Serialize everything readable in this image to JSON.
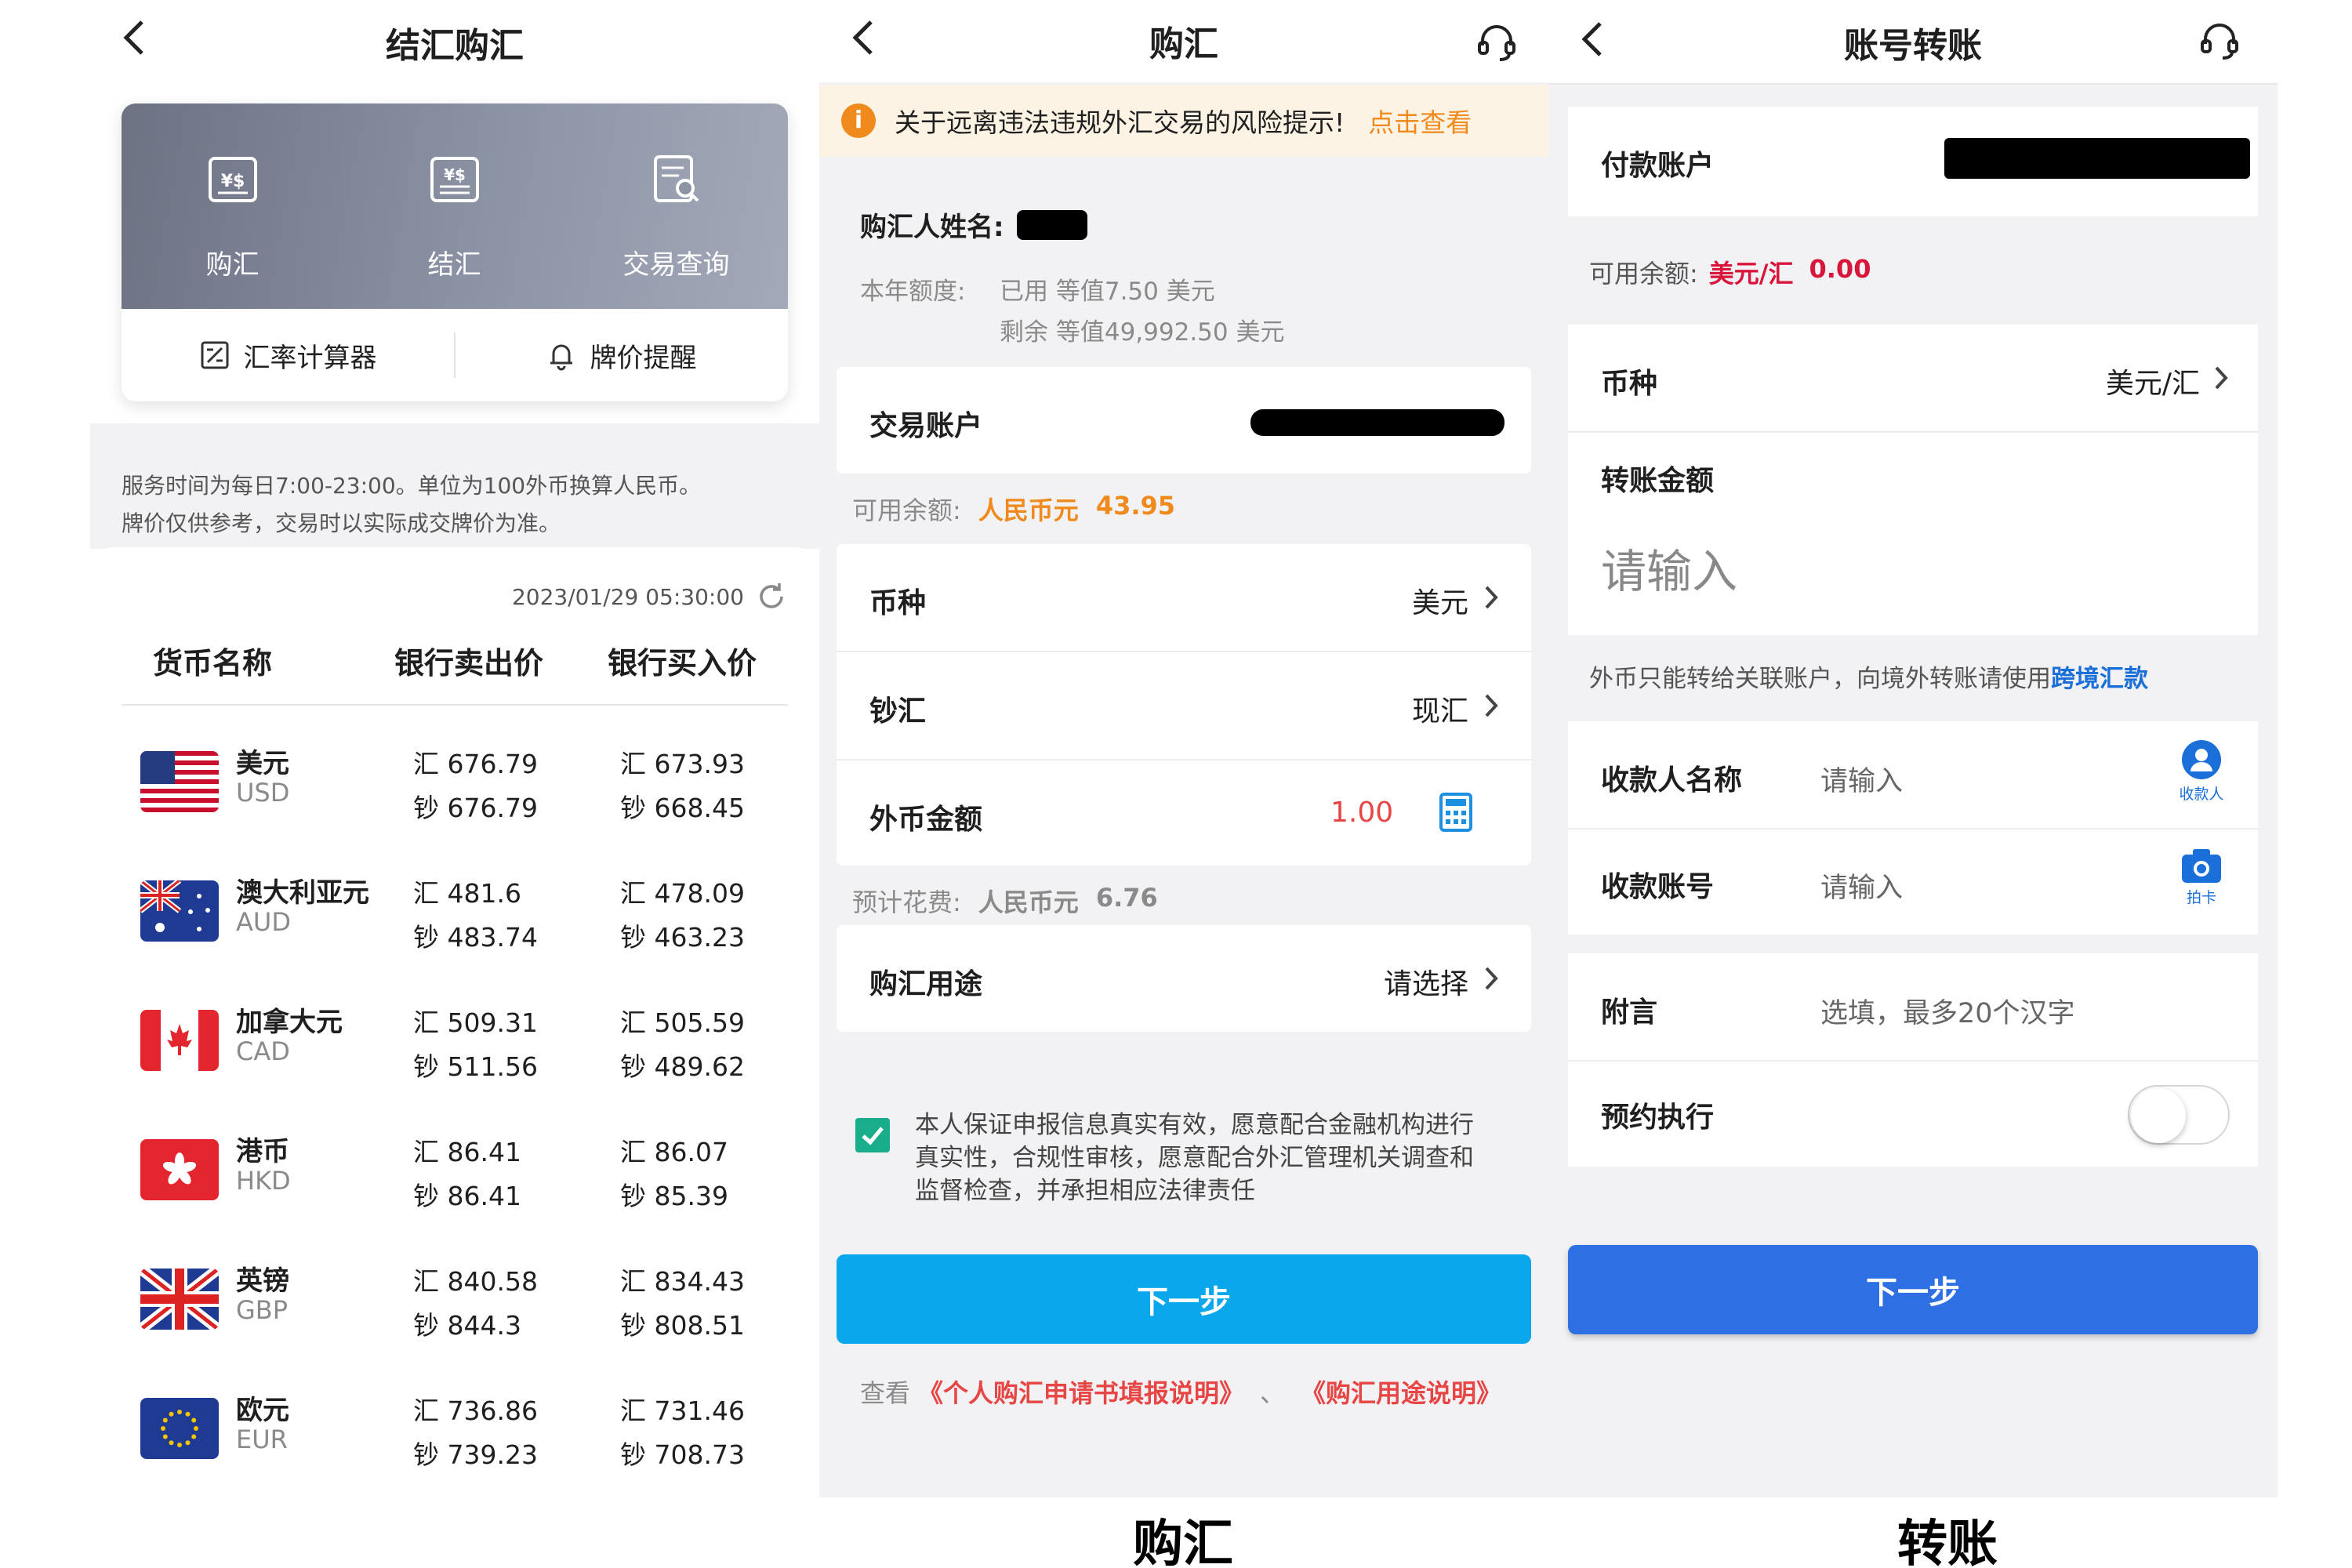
{
  "panel1": {
    "title": "结汇购汇",
    "quick_actions": [
      {
        "label": "购汇",
        "icon": "buy-fx-icon"
      },
      {
        "label": "结汇",
        "icon": "sell-fx-icon"
      },
      {
        "label": "交易查询",
        "icon": "query-icon"
      }
    ],
    "tools": [
      {
        "label": "汇率计算器",
        "icon": "calculator-icon"
      },
      {
        "label": "牌价提醒",
        "icon": "bell-icon"
      }
    ],
    "notice_line1": "服务时间为每日7:00-23:00。单位为100外币换算人民币。",
    "notice_line2": "牌价仅供参考，交易时以实际成交牌价为准。",
    "timestamp": "2023/01/29 05:30:00",
    "columns": [
      "货币名称",
      "银行卖出价",
      "银行买入价"
    ],
    "currencies": [
      {
        "name": "美元",
        "code": "USD",
        "flag": "us",
        "sell_hui": "汇 676.79",
        "sell_chao": "钞 676.79",
        "buy_hui": "汇 673.93",
        "buy_chao": "钞 668.45"
      },
      {
        "name": "澳大利亚元",
        "code": "AUD",
        "flag": "au",
        "sell_hui": "汇 481.6",
        "sell_chao": "钞 483.74",
        "buy_hui": "汇 478.09",
        "buy_chao": "钞 463.23"
      },
      {
        "name": "加拿大元",
        "code": "CAD",
        "flag": "ca",
        "sell_hui": "汇 509.31",
        "sell_chao": "钞 511.56",
        "buy_hui": "汇 505.59",
        "buy_chao": "钞 489.62"
      },
      {
        "name": "港币",
        "code": "HKD",
        "flag": "hk",
        "sell_hui": "汇 86.41",
        "sell_chao": "钞 86.41",
        "buy_hui": "汇 86.07",
        "buy_chao": "钞 85.39"
      },
      {
        "name": "英镑",
        "code": "GBP",
        "flag": "gb",
        "sell_hui": "汇 840.58",
        "sell_chao": "钞 844.3",
        "buy_hui": "汇 834.43",
        "buy_chao": "钞 808.51"
      },
      {
        "name": "欧元",
        "code": "EUR",
        "flag": "eu",
        "sell_hui": "汇 736.86",
        "sell_chao": "钞 739.23",
        "buy_hui": "汇 731.46",
        "buy_chao": "钞 708.73"
      }
    ]
  },
  "panel2": {
    "title": "购汇",
    "warning_text": "关于远离违法违规外汇交易的风险提示!",
    "warning_link": "点击查看",
    "buyer_label": "购汇人姓名:",
    "quota_label": "本年额度:",
    "quota_used": "已用 等值7.50 美元",
    "quota_remain": "剩余 等值49,992.50 美元",
    "account_label": "交易账户",
    "balance_label": "可用余额:",
    "balance_currency": "人民币元",
    "balance_amount": "43.95",
    "currency_label": "币种",
    "currency_value": "美元",
    "cash_label": "钞汇",
    "cash_value": "现汇",
    "amount_label": "外币金额",
    "amount_value": "1.00",
    "cost_label": "预计花费:",
    "cost_currency": "人民币元",
    "cost_amount": "6.76",
    "purpose_label": "购汇用途",
    "purpose_value": "请选择",
    "agreement_line1": "本人保证申报信息真实有效，愿意配合金融机构进行",
    "agreement_line2": "真实性，合规性审核，愿意配合外汇管理机关调查和",
    "agreement_line3": "监督检查，并承担相应法律责任",
    "next_label": "下一步",
    "links_prefix": "查看",
    "link1": "《个人购汇申请书填报说明》",
    "links_sep": "、",
    "link2": "《购汇用途说明》",
    "colors": {
      "accent_orange": "#f08a1c",
      "button_blue": "#0aa7ec",
      "red": "#e84545",
      "check_green": "#1aad8c"
    }
  },
  "panel3": {
    "title": "账号转账",
    "payer_label": "付款账户",
    "balance_label": "可用余额:",
    "balance_currency": "美元/汇",
    "balance_amount": "0.00",
    "currency_label": "币种",
    "currency_value": "美元/汇",
    "amount_label": "转账金额",
    "amount_placeholder": "请输入",
    "tip_text": "外币只能转给关联账户，向境外转账请使用",
    "tip_link": "跨境汇款",
    "payee_name_label": "收款人名称",
    "payee_name_placeholder": "请输入",
    "payee_icon_label": "收款人",
    "payee_account_label": "收款账号",
    "payee_account_placeholder": "请输入",
    "camera_label": "拍卡",
    "memo_label": "附言",
    "memo_placeholder": "选填，最多20个汉字",
    "schedule_label": "预约执行",
    "schedule_enabled": false,
    "next_label": "下一步",
    "colors": {
      "crimson": "#d8163c",
      "link_blue": "#1b6fd8",
      "button_blue": "#2f6fe4"
    }
  },
  "captions": {
    "buy": "购汇",
    "transfer": "转账"
  }
}
